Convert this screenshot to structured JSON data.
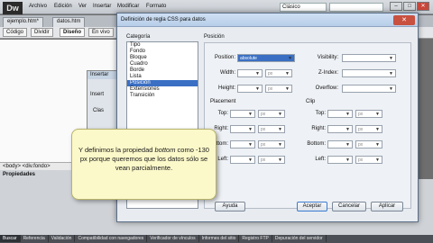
{
  "app": {
    "logo": "Dw",
    "workspace": "Clásico"
  },
  "menu": [
    "Archivo",
    "Edición",
    "Ver",
    "Insertar",
    "Modificar",
    "Formato"
  ],
  "window_buttons": {
    "minimize": "–",
    "maximize": "□",
    "close": "✕"
  },
  "doc_tabs": [
    "ejemplo.htm*",
    "datos.htm"
  ],
  "toolbar": {
    "code": "Código",
    "split": "Dividir",
    "design": "Diseño",
    "live": "En vivo"
  },
  "insert_dialog": {
    "title": "Insertar",
    "field1": "Insert",
    "field2": "Clas"
  },
  "statusbar": "<body> <div.fondo>",
  "properties": "Propiedades",
  "dialog": {
    "title": "Definición de regla CSS para datos",
    "close": "✕",
    "category_label": "Categoría",
    "categories": [
      "Tipo",
      "Fondo",
      "Bloque",
      "Cuadro",
      "Borde",
      "Lista",
      "Posición",
      "Extensiones",
      "Transición"
    ],
    "selected_category": "Posición",
    "section_label": "Posición",
    "fields": {
      "position": {
        "label": "Position:",
        "value": "absolute"
      },
      "visibility": {
        "label": "Visibility:",
        "value": ""
      },
      "width": {
        "label": "Width:",
        "value": "",
        "unit": "px"
      },
      "zindex": {
        "label": "Z-Index:",
        "value": ""
      },
      "height": {
        "label": "Height:",
        "value": "",
        "unit": "px"
      },
      "overflow": {
        "label": "Overflow:",
        "value": ""
      }
    },
    "placement": {
      "label": "Placement",
      "top": "Top:",
      "right": "Right:",
      "bottom": "Bottom:",
      "left": "Left:",
      "unit": "px"
    },
    "clip": {
      "label": "Clip",
      "top": "Top:",
      "right": "Right:",
      "bottom": "Bottom:",
      "left": "Left:",
      "unit": "px"
    },
    "buttons": {
      "help": "Ayuda",
      "ok": "Aceptar",
      "cancel": "Cancelar",
      "apply": "Aplicar"
    }
  },
  "caption": {
    "before": "Y definimos la propiedad ",
    "emph": "bottom",
    "after": " como -130 px porque queremos que los datos sólo se vean parcialmente."
  },
  "bottom_tabs": [
    "Buscar",
    "Referencia",
    "Validación",
    "Compatibilidad con navegadores",
    "Verificador de vínculos",
    "Informes del sitio",
    "Registro FTP",
    "Depuración del servidor"
  ]
}
